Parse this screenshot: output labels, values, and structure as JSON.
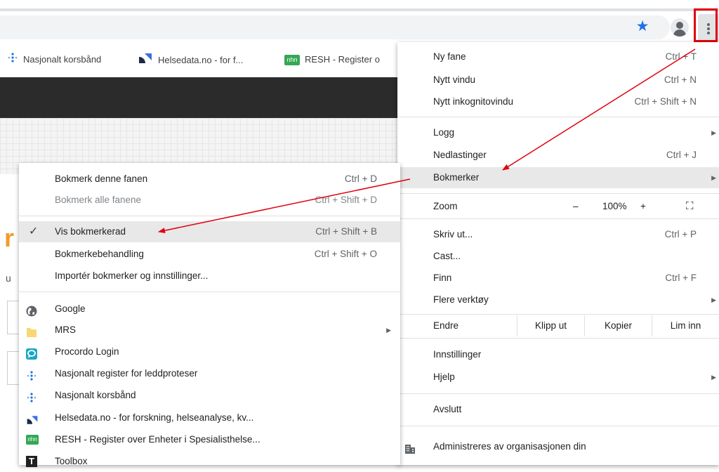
{
  "bookmarks_bar": [
    {
      "icon": "dots-icon",
      "label": "Nasjonalt korsbånd"
    },
    {
      "icon": "helsedata-icon",
      "label": "Helsedata.no - for f..."
    },
    {
      "icon": "nhn-icon",
      "label": "RESH - Register o",
      "badge": "nhn"
    }
  ],
  "chrome_menu": {
    "group1": [
      {
        "label": "Ny fane",
        "shortcut": "Ctrl + T"
      },
      {
        "label": "Nytt vindu",
        "shortcut": "Ctrl + N"
      },
      {
        "label": "Nytt inkognitovindu",
        "shortcut": "Ctrl + Shift + N"
      }
    ],
    "group2": [
      {
        "label": "Logg",
        "shortcut": "",
        "submenu": true
      },
      {
        "label": "Nedlastinger",
        "shortcut": "Ctrl + J"
      },
      {
        "label": "Bokmerker",
        "shortcut": "",
        "submenu": true,
        "highlighted": true
      }
    ],
    "zoom": {
      "label": "Zoom",
      "minus": "–",
      "value": "100%",
      "plus": "+",
      "fullscreen": "⛶"
    },
    "group3": [
      {
        "label": "Skriv ut...",
        "shortcut": "Ctrl + P"
      },
      {
        "label": "Cast...",
        "shortcut": ""
      },
      {
        "label": "Finn",
        "shortcut": "Ctrl + F"
      },
      {
        "label": "Flere verktøy",
        "shortcut": "",
        "submenu": true
      }
    ],
    "edit": {
      "label": "Endre",
      "cut": "Klipp ut",
      "copy": "Kopier",
      "paste": "Lim inn"
    },
    "group4": [
      {
        "label": "Innstillinger",
        "shortcut": ""
      },
      {
        "label": "Hjelp",
        "shortcut": "",
        "submenu": true
      }
    ],
    "exit": {
      "label": "Avslutt"
    },
    "managed": {
      "label": "Administreres av organisasjonen din"
    }
  },
  "bookmarks_submenu": {
    "actions": [
      {
        "label": "Bokmerk denne fanen",
        "shortcut": "Ctrl + D"
      },
      {
        "label": "Bokmerk alle fanene",
        "shortcut": "Ctrl + Shift + D",
        "disabled": true
      }
    ],
    "toggles": [
      {
        "label": "Vis bokmerkerad",
        "shortcut": "Ctrl + Shift + B",
        "checked": true,
        "highlighted": true
      },
      {
        "label": "Bokmerkebehandling",
        "shortcut": "Ctrl + Shift + O"
      },
      {
        "label": "Importér bokmerker og innstillinger...",
        "shortcut": ""
      }
    ],
    "bookmarks": [
      {
        "icon": "globe-icon",
        "label": "Google"
      },
      {
        "icon": "folder-icon",
        "label": "MRS",
        "submenu": true
      },
      {
        "icon": "procordo-icon",
        "label": "Procordo Login"
      },
      {
        "icon": "dots-icon",
        "label": "Nasjonalt register for leddproteser"
      },
      {
        "icon": "dots-icon",
        "label": "Nasjonalt korsbånd"
      },
      {
        "icon": "helsedata-icon",
        "label": "Helsedata.no - for forskning, helseanalyse, kv..."
      },
      {
        "icon": "nhn-icon",
        "label": "RESH - Register over Enheter i Spesialisthelse...",
        "badge": "nhn"
      },
      {
        "icon": "toolbox-icon",
        "label": "Toolbox",
        "badge": "T"
      }
    ]
  },
  "page": {
    "orange_fragment": "r",
    "letter": "u"
  },
  "colors": {
    "accent": "#1a73e8",
    "annotation": "#e0000d",
    "menu_highlight": "#e8e8e8"
  }
}
